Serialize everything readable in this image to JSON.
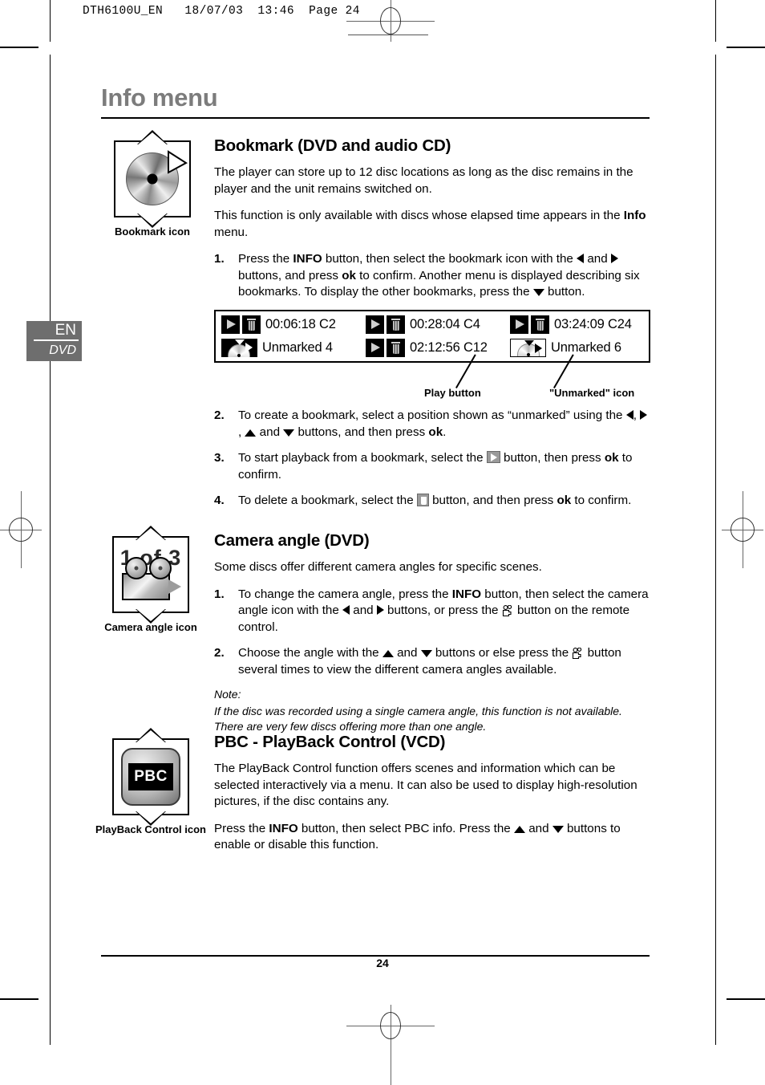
{
  "printmark": {
    "filestamp": "DTH6100U_EN   18/07/03  13:46  Page 24"
  },
  "header": {
    "title": "Info menu"
  },
  "lang_badge": {
    "language": "EN",
    "media": "DVD"
  },
  "sections": [
    {
      "id": "bookmark",
      "heading": "Bookmark (DVD and audio CD)",
      "icon_caption": "Bookmark icon",
      "intro": [
        "The player can store up to 12 disc locations as long as the disc remains in the player and the unit remains switched on.",
        "This function is only available with discs whose elapsed time appears in the Info menu."
      ],
      "steps": [
        {
          "num": "1.",
          "text": "Press the INFO button, then select the bookmark icon with the ◀ and ➤ buttons, and press ok to confirm. Another menu is displayed describing six bookmarks. To display the other bookmarks, press the ▼ button."
        },
        {
          "num": "2.",
          "text": "To create a bookmark, select a position shown as “unmarked” using the ◀, ➤, ▲ and ▼ buttons, and then press ok."
        },
        {
          "num": "3.",
          "text": "To start playback from a bookmark, select the ▷ button, then press ok to confirm."
        },
        {
          "num": "4.",
          "text": "To delete a bookmark, select the 🗑 button, and then press ok to confirm."
        }
      ]
    },
    {
      "id": "camera-angle",
      "heading": "Camera angle (DVD)",
      "icon_caption": "Camera angle icon",
      "icon_text": "1 of 3",
      "intro": [
        "Some discs offer different camera angles for specific scenes."
      ],
      "steps": [
        {
          "num": "1.",
          "text": "To change the camera angle, press the INFO button, then select the camera angle icon with the ◀ and ➤ buttons, or press the camera button on the remote control."
        },
        {
          "num": "2.",
          "text": "Choose the angle with the ▲ and ▼ buttons or else press the camera button several times to view the different camera angles available."
        }
      ],
      "note_label": "Note:",
      "note_text": "If the disc was recorded using a single camera angle, this function is not available. There are very few discs offering more than one angle."
    },
    {
      "id": "pbc",
      "heading": "PBC - PlayBack Control (VCD)",
      "icon_caption": "PlayBack Control icon",
      "icon_text": "PBC",
      "paragraphs": [
        "The PlayBack Control function offers scenes and information which can be selected interactively via a menu. It can also be used to display high-resolution pictures, if the disc contains any.",
        "Press the INFO button, then select PBC info. Press the ▲ and ▼ buttons to enable or disable this function."
      ]
    }
  ],
  "bookmark_menu": {
    "cells": [
      {
        "type": "bookmark",
        "time": "00:06:18 C2"
      },
      {
        "type": "bookmark",
        "time": "00:28:04 C4"
      },
      {
        "type": "bookmark",
        "time": "03:24:09 C24"
      },
      {
        "type": "unmarked",
        "time": "Unmarked 4",
        "selected": false
      },
      {
        "type": "bookmark",
        "time": "02:12:56 C12"
      },
      {
        "type": "unmarked",
        "time": "Unmarked 6",
        "selected": true
      }
    ],
    "callouts": [
      {
        "label": "Play button"
      },
      {
        "label": "\"Unmarked\" icon"
      }
    ]
  },
  "footer": {
    "page_number": "24"
  }
}
